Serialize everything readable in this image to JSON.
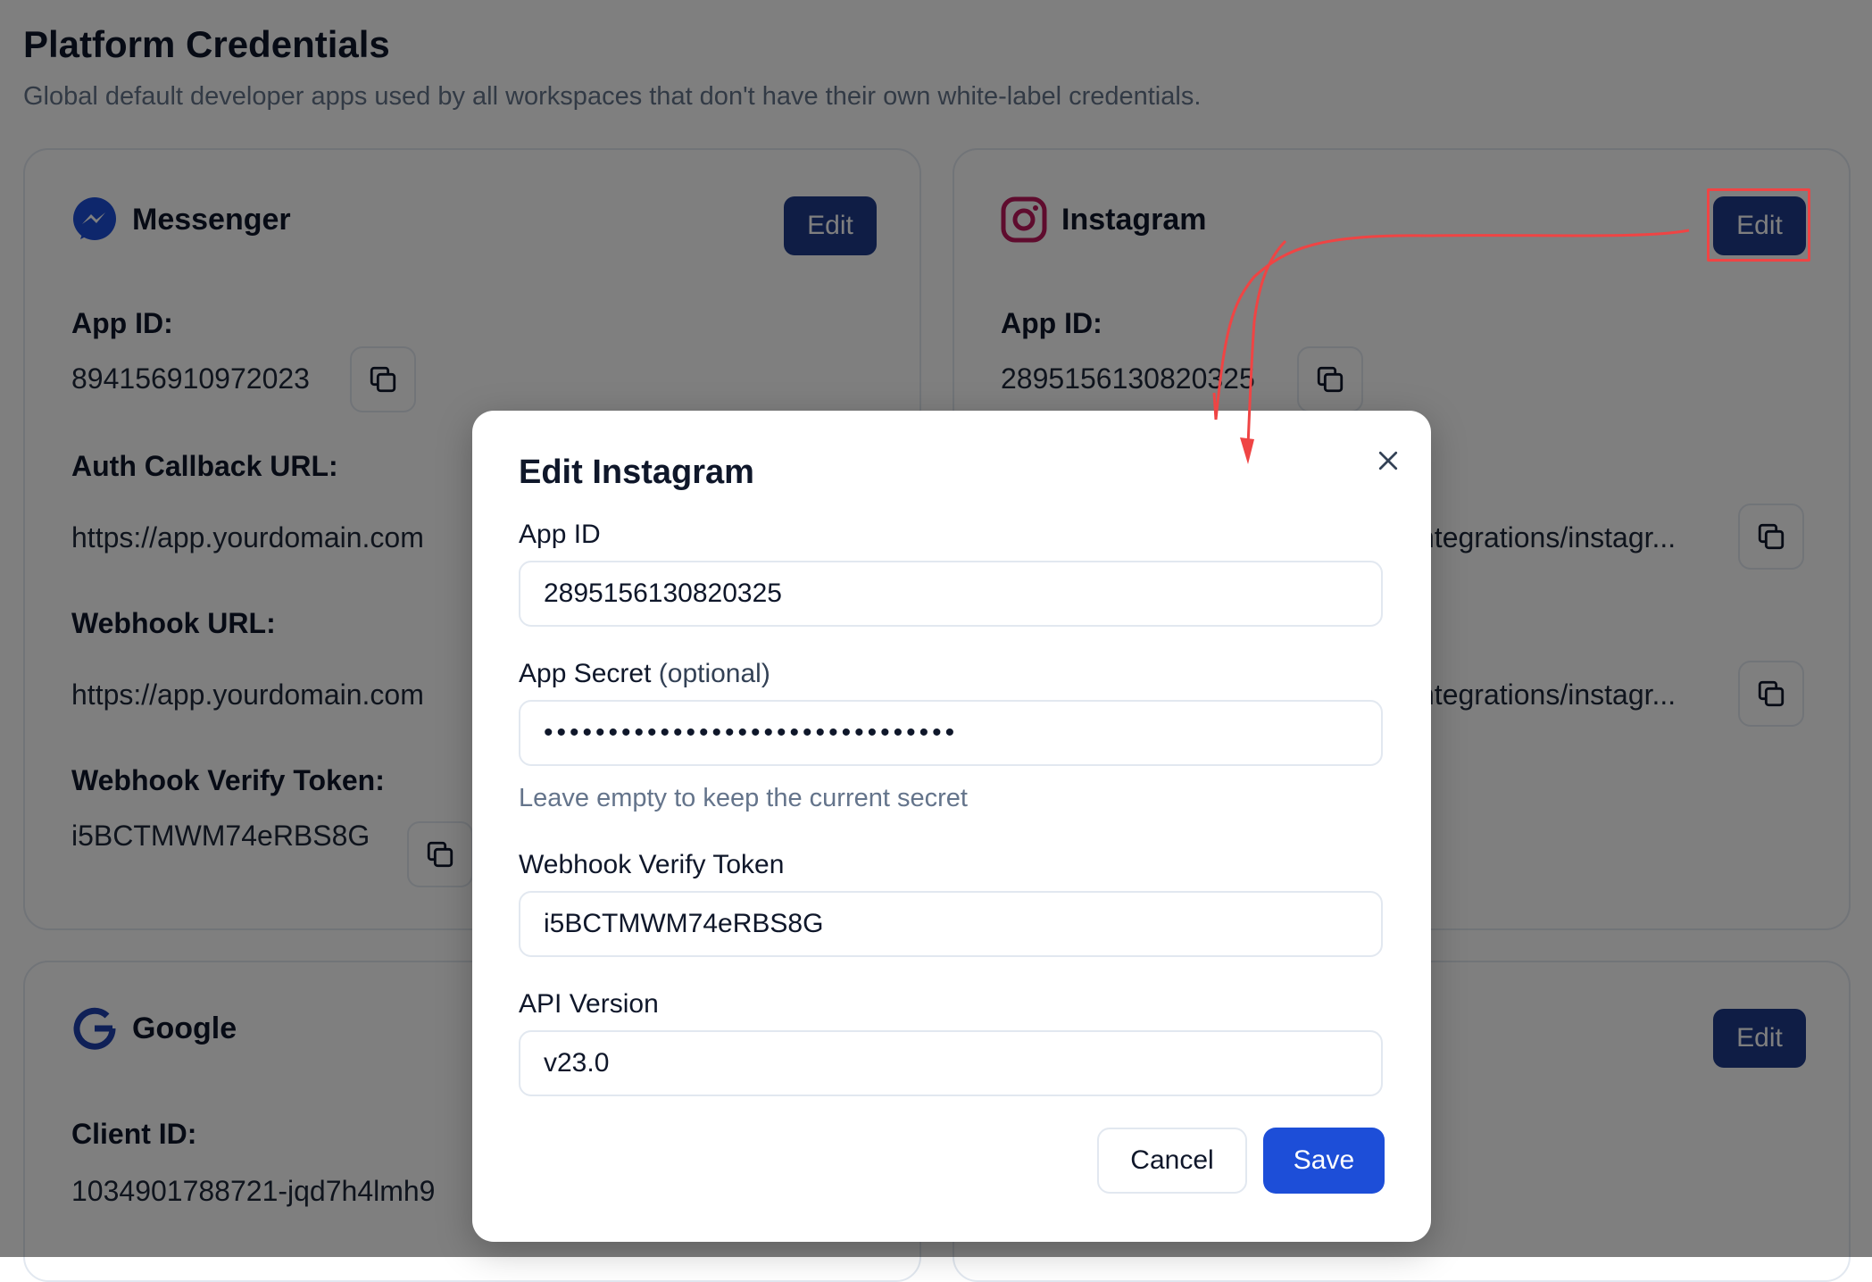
{
  "page": {
    "title": "Platform Credentials",
    "subtitle": "Global default developer apps used by all workspaces that don't have their own white-label credentials."
  },
  "messenger": {
    "name": "Messenger",
    "edit_label": "Edit",
    "app_id_label": "App ID:",
    "app_id": "894156910972023",
    "auth_callback_label": "Auth Callback URL:",
    "auth_callback_url": "https://app.yourdomain.com",
    "webhook_label": "Webhook URL:",
    "webhook_url": "https://app.yourdomain.com",
    "verify_token_label": "Webhook Verify Token:",
    "verify_token": "i5BCTMWM74eRBS8G"
  },
  "instagram": {
    "name": "Instagram",
    "edit_label": "Edit",
    "app_id_label": "App ID:",
    "app_id": "2895156130820325",
    "auth_callback_tail": "ntegrations/instagr...",
    "webhook_tail": "ntegrations/instagr..."
  },
  "google": {
    "name": "Google",
    "client_id_label": "Client ID:",
    "client_id": "1034901788721-jqd7h4lmh9"
  },
  "fourth_card": {
    "edit_label": "Edit"
  },
  "modal": {
    "title": "Edit Instagram",
    "app_id_label": "App ID",
    "app_id_value": "2895156130820325",
    "secret_label": "App Secret",
    "secret_optional": "(optional)",
    "secret_value": "••••••••••••••••••••••••••••••••",
    "secret_hint": "Leave empty to keep the current secret",
    "verify_token_label": "Webhook Verify Token",
    "verify_token_value": "i5BCTMWM74eRBS8G",
    "api_version_label": "API Version",
    "api_version_value": "v23.0",
    "cancel_label": "Cancel",
    "save_label": "Save"
  },
  "colors": {
    "edit_button": "#1e3a8a",
    "save_button": "#1d4ed8",
    "annotation": "#ef4444",
    "messenger_brand": "#1d4ed8",
    "instagram_brand": "#be185d",
    "google_brand": "#1e40af"
  },
  "icons": {
    "messenger": "messenger-icon",
    "instagram": "instagram-icon",
    "google": "google-icon",
    "copy": "copy-icon",
    "close": "close-icon"
  }
}
